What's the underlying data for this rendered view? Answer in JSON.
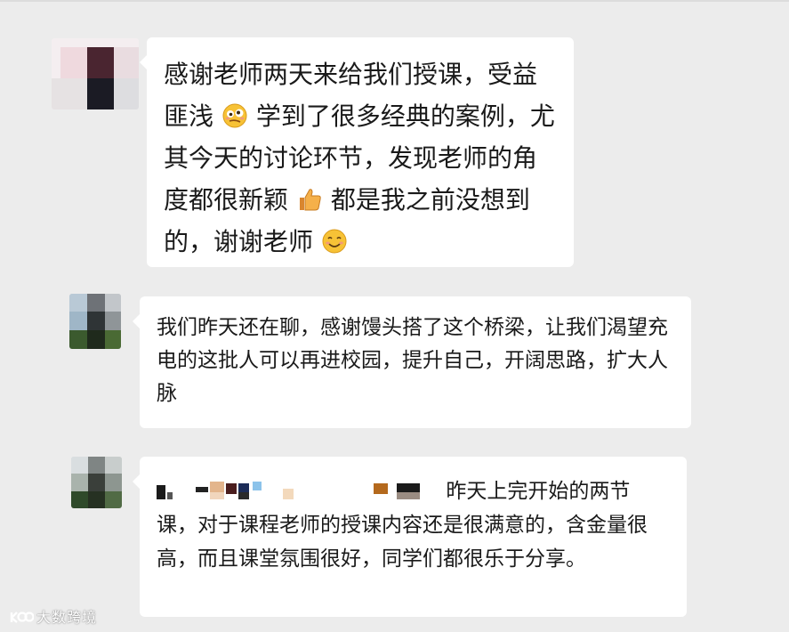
{
  "messages": [
    {
      "parts": [
        "感谢老师两天来给我们授课，受益匪浅",
        "学到了很多经典的案例，尤其今天的讨论环节，发现老师的角度都很新颖",
        "都是我之前没想到的，谢谢老师"
      ],
      "emojis": [
        "woozy-face-emoji",
        "thumbs-up-emoji",
        "smiling-face-emoji"
      ]
    },
    {
      "text": "我们昨天还在聊，感谢馒头搭了这个桥梁，让我们渴望充电的这批人可以再进校园，提升自己，开阔思路，扩大人脉"
    },
    {
      "text": "昨天上完开始的两节课，对于课程老师的授课内容还是很满意的，含金量很高，而且课堂氛围很好，同学们都很乐于分享。",
      "mention_redacted": true
    }
  ],
  "watermark": {
    "text": "大数跨境",
    "icon": "watermark-logo-icon"
  },
  "colors": {
    "background": "#ececec",
    "bubble": "#ffffff",
    "text": "#1a1a1a"
  }
}
